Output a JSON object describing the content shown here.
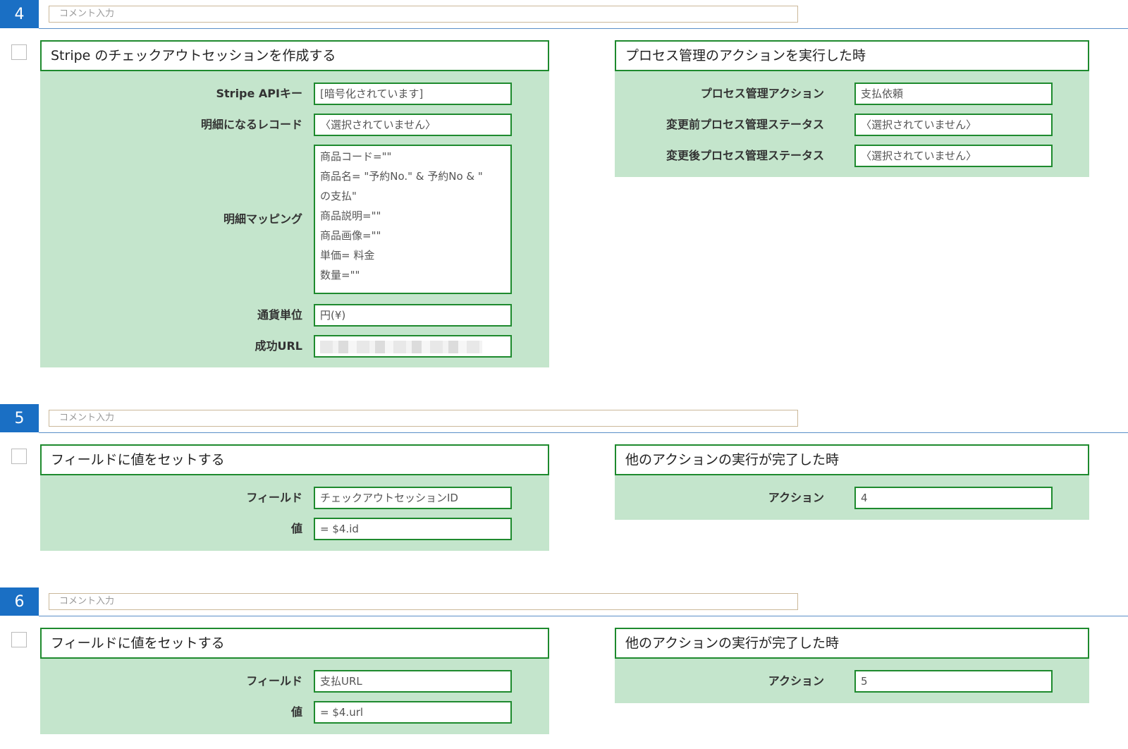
{
  "steps": [
    {
      "number": "4",
      "comment_placeholder": "コメント入力",
      "action": {
        "title": "Stripe のチェックアウトセッションを作成する",
        "fields": [
          {
            "label": "Stripe APIキー",
            "value": "[暗号化されています]"
          },
          {
            "label": "明細になるレコード",
            "value": "〈選択されていません〉"
          },
          {
            "label": "明細マッピング",
            "lines": [
              "商品コード=\"\"",
              "商品名= \"予約No.\" & 予約No & \"",
              "の支払\"",
              "商品説明=\"\"",
              "商品画像=\"\"",
              "単価= 料金",
              "数量=\"\""
            ]
          },
          {
            "label": "通貨単位",
            "value": "円(¥)"
          },
          {
            "label": "成功URL",
            "value": ""
          }
        ]
      },
      "trigger": {
        "title": "プロセス管理のアクションを実行した時",
        "fields": [
          {
            "label": "プロセス管理アクション",
            "value": "支払依頼"
          },
          {
            "label": "変更前プロセス管理ステータス",
            "value": "〈選択されていません〉"
          },
          {
            "label": "変更後プロセス管理ステータス",
            "value": "〈選択されていません〉"
          }
        ]
      }
    },
    {
      "number": "5",
      "comment_placeholder": "コメント入力",
      "action": {
        "title": "フィールドに値をセットする",
        "fields": [
          {
            "label": "フィールド",
            "value": "チェックアウトセッションID"
          },
          {
            "label": "値",
            "value": "= $4.id"
          }
        ]
      },
      "trigger": {
        "title": "他のアクションの実行が完了した時",
        "fields": [
          {
            "label": "アクション",
            "value": "4"
          }
        ]
      }
    },
    {
      "number": "6",
      "comment_placeholder": "コメント入力",
      "action": {
        "title": "フィールドに値をセットする",
        "fields": [
          {
            "label": "フィールド",
            "value": "支払URL"
          },
          {
            "label": "値",
            "value": "= $4.url"
          }
        ]
      },
      "trigger": {
        "title": "他のアクションの実行が完了した時",
        "fields": [
          {
            "label": "アクション",
            "value": "5"
          }
        ]
      }
    }
  ],
  "colors": {
    "step_badge": "#1a6fc4",
    "panel_bg": "#c4e5cc",
    "field_border": "#1e8a2e"
  }
}
